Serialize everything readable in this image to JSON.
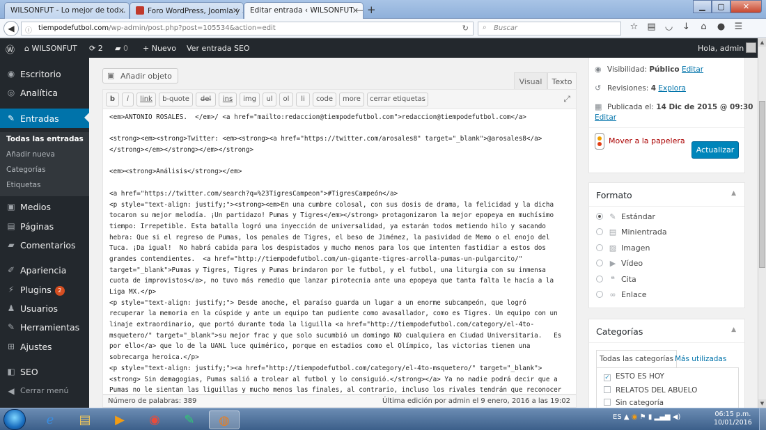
{
  "browser": {
    "tabs": [
      {
        "label": "WILSONFUT - Lo mejor de tod..."
      },
      {
        "label": "Foro WordPress, Joomla y ..."
      },
      {
        "label": "Editar entrada ‹ WILSONFUT —..."
      }
    ],
    "url_host": "tiempodefutbol.com",
    "url_path": "/wp-admin/post.php?post=105534&action=edit",
    "search_placeholder": "Buscar"
  },
  "adminbar": {
    "site_name": "WILSONFUT",
    "updates_count": "2",
    "comments_count": "0",
    "new_label": "Nuevo",
    "view_post": "Ver entrada",
    "seo": "SEO",
    "greeting": "Hola, admin"
  },
  "sidebar": {
    "items": [
      {
        "label": "Escritorio",
        "icon": "dashboard-icon"
      },
      {
        "label": "Analítica",
        "icon": "analytics-icon"
      },
      {
        "label": "Entradas",
        "icon": "pin-icon"
      },
      {
        "label": "Medios",
        "icon": "media-icon"
      },
      {
        "label": "Páginas",
        "icon": "pages-icon"
      },
      {
        "label": "Comentarios",
        "icon": "comments-icon"
      },
      {
        "label": "Apariencia",
        "icon": "appearance-icon"
      },
      {
        "label": "Plugins",
        "icon": "plugins-icon",
        "badge": "2"
      },
      {
        "label": "Usuarios",
        "icon": "users-icon"
      },
      {
        "label": "Herramientas",
        "icon": "tools-icon"
      },
      {
        "label": "Ajustes",
        "icon": "settings-icon"
      },
      {
        "label": "SEO",
        "icon": "seo-icon"
      },
      {
        "label": "Cerrar menú",
        "icon": "collapse-icon"
      }
    ],
    "submenu": [
      "Todas las entradas",
      "Añadir nueva",
      "Categorías",
      "Etiquetas"
    ]
  },
  "editor": {
    "add_media": "Añadir objeto",
    "tab_visual": "Visual",
    "tab_text": "Texto",
    "quicktags": [
      "b",
      "i",
      "link",
      "b-quote",
      "del",
      "ins",
      "img",
      "ul",
      "ol",
      "li",
      "code",
      "more",
      "cerrar etiquetas"
    ],
    "lines": [
      "<em>ANTONIO ROSALES.  </em>/ <a href=\"mailto:redaccion@tiempodefutbol.com\">redaccion@tiempodefutbol.com</a>",
      "",
      "<strong><em><strong>Twitter: <em><strong><a href=\"https://twitter.com/arosales8\" target=\"_blank\">@arosales8</a>",
      "</strong></em></strong></em></strong>",
      "",
      "<em><strong>Análisis</strong></em>",
      "",
      "<a href=\"https://twitter.com/search?q=%23TigresCampeon\">#TigresCampeón</a>",
      "<p style=\"text-align: justify;\"><strong><em>En una cumbre colosal, con sus dosis de drama, la felicidad y la dicha",
      "tocaron su mejor melodía. ¡Un partidazo! Pumas y Tigres</em></strong> protagonizaron la mejor epopeya en muchísimo",
      "tiempo: Irrepetible. Esta batalla logró una inyección de universalidad, ya estarán todos metiendo hilo y sacando",
      "hebra: Que si el regreso de Pumas, los penales de Tigres, el beso de Jiménez, la pasividad de Memo o el enojo del",
      "Tuca. ¡Da igual!  No habrá cabida para los despistados y mucho menos para los que intenten fastidiar a estos dos",
      "grandes contendientes.  <a href=\"http://tiempodefutbol.com/un-gigante-tigres-arrolla-pumas-un-pulgarcito/\"",
      "target=\"_blank\">Pumas y Tigres, Tigres y Pumas brindaron por le futbol, y el futbol, una liturgia con su inmensa",
      "cuota de improvistos</a>, no tuvo más remedio que lanzar pirotecnia ante una epopeya que tanta falta le hacía a la",
      "Liga MX.</p>",
      "<p style=\"text-align: justify;\"> Desde anoche, el paraíso guarda un lugar a un enorme subcampeón, que logró",
      "recuperar la memoria en la cúspide y ante un equipo tan pudiente como avasallador, como es Tigres. Un equipo con un",
      "linaje extraordinario, que portó durante toda la liguilla <a href=\"http://tiempodefutbol.com/category/el-4to-",
      "msquetero/\" target=\"_blank\">su mejor frac y que solo sucumbió un domingo NO cualquiera en Ciudad Universitaria.   Es",
      "por ello</a> que lo de la UANL luce quimérico, porque en estadios como el Olímpico, las victorias tienen una",
      "sobrecarga heroica.</p>",
      "<p style=\"text-align: justify;\"><a href=\"http://tiempodefutbol.com/category/el-4to-msquetero/\" target=\"_blank\">",
      "<strong> Sin demagogias, Pumas salió a trolear al futbol y lo consiguió.</strong></a> Ya no nadie podrá decir que a",
      "Pumas no le sientan las liguillas y mucho menos las finales, al contrario, incluso los rivales tendrán que reconocer"
    ],
    "word_count": "Número de palabras: 389",
    "last_edit": "Última edición por admin el 9 enero, 2016 a las 19:02"
  },
  "publish": {
    "visibility_label": "Visibilidad:",
    "visibility_value": "Público",
    "revisions_label": "Revisiones:",
    "revisions_value": "4",
    "published_label": "Publicada el:",
    "published_value": "14 Dic de 2015 @ 09:30",
    "edit": "Editar",
    "browse": "Explora",
    "trash": "Mover a la papelera",
    "update": "Actualizar"
  },
  "format": {
    "title": "Formato",
    "options": [
      {
        "label": "Estándar",
        "icon": "pin-icon",
        "selected": true
      },
      {
        "label": "Minientrada",
        "icon": "aside-icon",
        "selected": false
      },
      {
        "label": "Imagen",
        "icon": "image-icon",
        "selected": false
      },
      {
        "label": "Vídeo",
        "icon": "video-icon",
        "selected": false
      },
      {
        "label": "Cita",
        "icon": "quote-icon",
        "selected": false
      },
      {
        "label": "Enlace",
        "icon": "link-icon",
        "selected": false
      }
    ]
  },
  "categories": {
    "title": "Categorías",
    "tab_all": "Todas las categorías",
    "tab_popular": "Más utilizadas",
    "items": [
      {
        "label": "ESTO ES HOY",
        "checked": true
      },
      {
        "label": "RELATOS DEL ABUELO",
        "checked": false
      },
      {
        "label": "Sin categoría",
        "checked": false
      }
    ]
  },
  "taskbar": {
    "lang": "ES",
    "time": "06:15 p.m.",
    "date": "10/01/2016"
  }
}
